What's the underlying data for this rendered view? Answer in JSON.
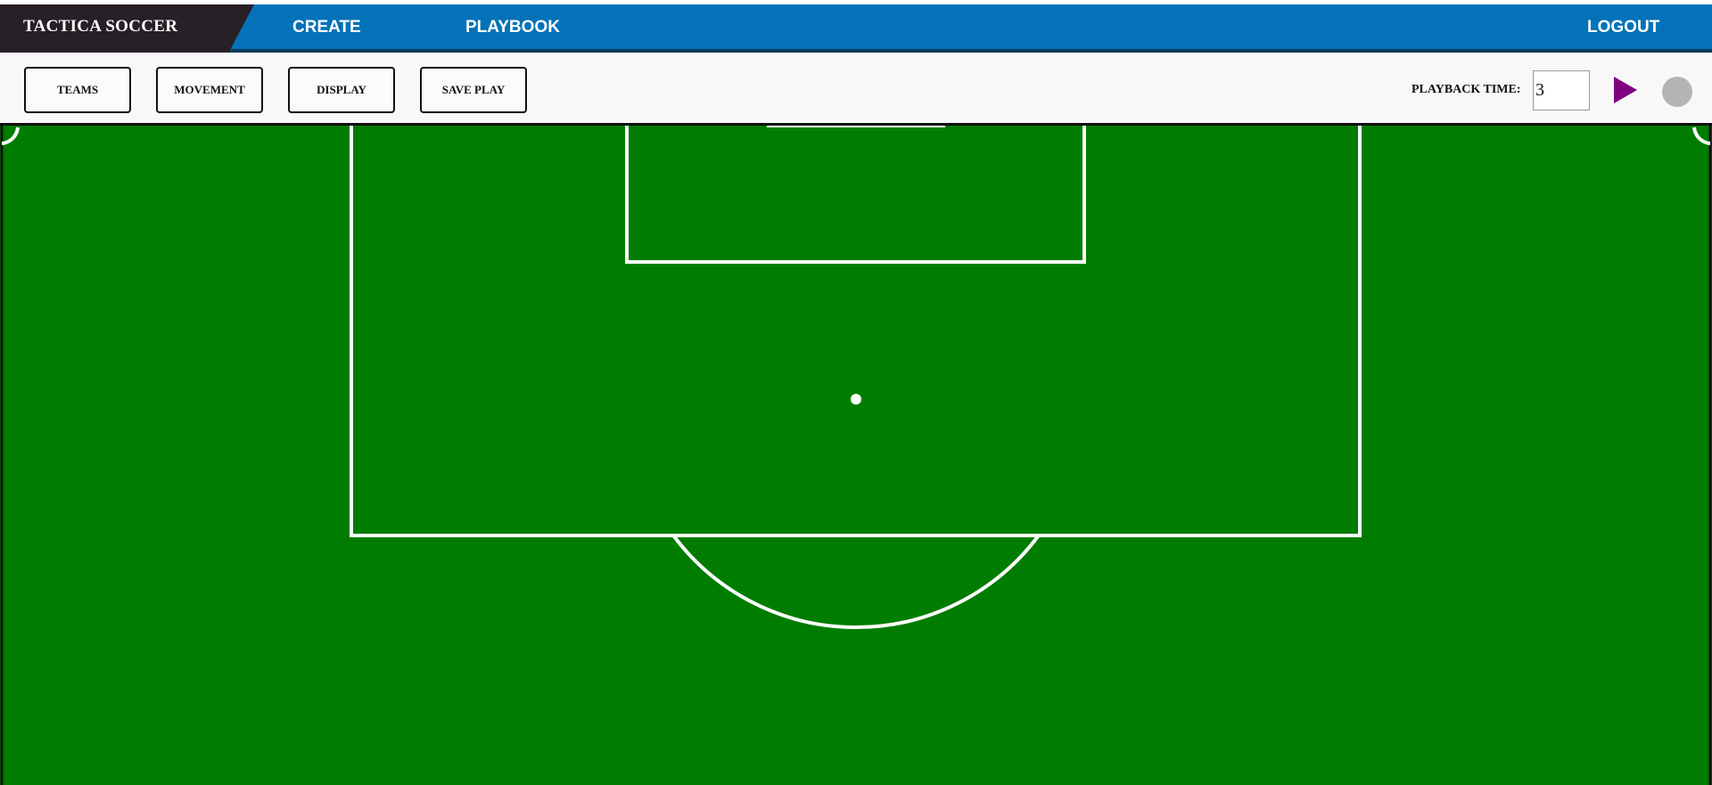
{
  "brand": {
    "name": "TACTICA SOCCER"
  },
  "nav": {
    "create": "CREATE",
    "playbook": "PLAYBOOK",
    "logout": "LOGOUT"
  },
  "toolbar": {
    "teams": "TEAMS",
    "movement": "MOVEMENT",
    "display": "DISPLAY",
    "save_play": "SAVE PLAY",
    "playback_label": "PLAYBACK TIME:",
    "playback_value": "3",
    "play_icon": "play-icon",
    "record_icon": "record-icon"
  },
  "colors": {
    "nav_bar": "#0372b8",
    "brand_bg": "#272127",
    "pitch": "#007c00",
    "lines": "#ffffff",
    "play": "#800080",
    "record": "#b4b4b4"
  }
}
